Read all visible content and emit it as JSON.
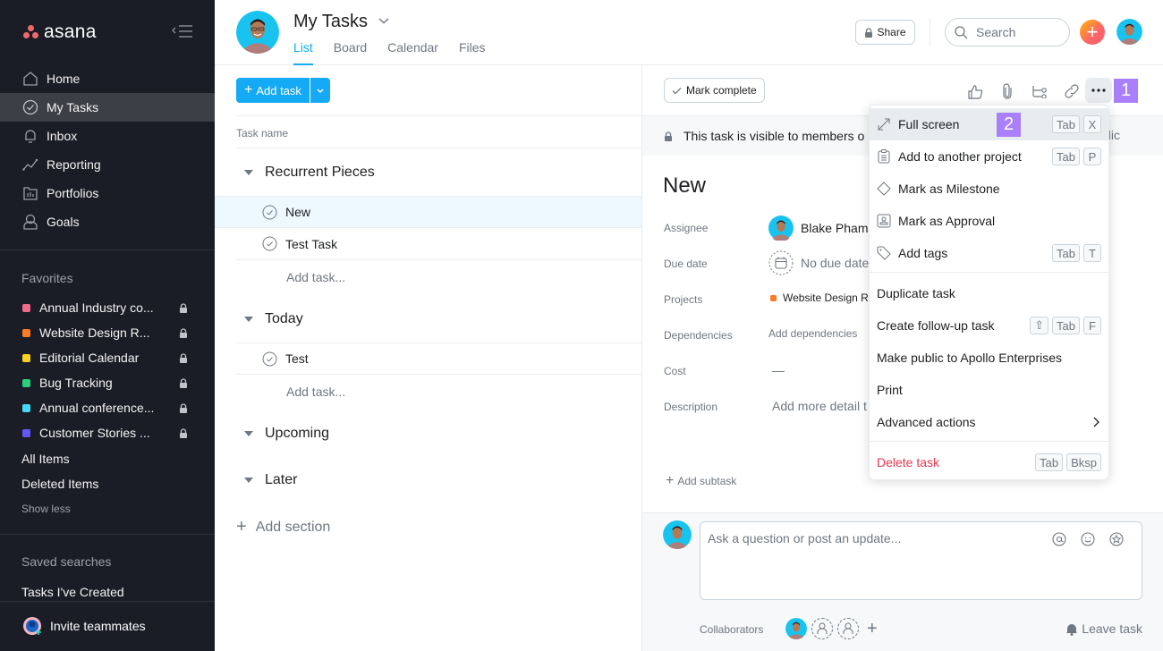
{
  "sidebar": {
    "logo_text": "asana",
    "nav": [
      {
        "label": "Home",
        "icon": "home-icon"
      },
      {
        "label": "My Tasks",
        "icon": "check-circle-icon",
        "active": true
      },
      {
        "label": "Inbox",
        "icon": "bell-icon"
      },
      {
        "label": "Reporting",
        "icon": "line-chart-icon"
      },
      {
        "label": "Portfolios",
        "icon": "portfolio-icon"
      },
      {
        "label": "Goals",
        "icon": "goals-icon"
      }
    ],
    "favorites_label": "Favorites",
    "favorites": [
      {
        "label": "Annual Industry co...",
        "color": "#f06a8a"
      },
      {
        "label": "Website Design R...",
        "color": "#fd7b23"
      },
      {
        "label": "Editorial Calendar",
        "color": "#f8d21c"
      },
      {
        "label": "Bug Tracking",
        "color": "#29d07c"
      },
      {
        "label": "Annual conference...",
        "color": "#43d9f7"
      },
      {
        "label": "Customer Stories ...",
        "color": "#6457f9"
      }
    ],
    "all_items": "All Items",
    "deleted_items": "Deleted Items",
    "show_less": "Show less",
    "saved_searches_label": "Saved searches",
    "saved_searches": [
      "Tasks I've Created"
    ],
    "invite": "Invite teammates"
  },
  "header": {
    "title": "My Tasks",
    "tabs": [
      "List",
      "Board",
      "Calendar",
      "Files"
    ],
    "active_tab": "List",
    "share": "Share",
    "search_placeholder": "Search"
  },
  "list": {
    "add_task": "Add task",
    "column_header": "Task name",
    "sections": [
      {
        "name": "Recurrent Pieces",
        "tasks": [
          "New",
          "Test Task"
        ],
        "add": "Add task..."
      },
      {
        "name": "Today",
        "tasks": [
          "Test"
        ],
        "add": "Add task..."
      },
      {
        "name": "Upcoming",
        "tasks": []
      },
      {
        "name": "Later",
        "tasks": []
      }
    ],
    "add_section": "Add section"
  },
  "detail": {
    "mark_complete": "Mark complete",
    "badge1": "1",
    "visibility": "This task is visible to members o",
    "visibility_tail": "blic",
    "title": "New",
    "fields": {
      "assignee_label": "Assignee",
      "assignee": "Blake Pham",
      "due_label": "Due date",
      "due": "No due date",
      "projects_label": "Projects",
      "project": "Website Design R",
      "project_color": "#fd7b23",
      "dependencies_label": "Dependencies",
      "dependencies": "Add dependencies",
      "cost_label": "Cost",
      "cost": "—",
      "description_label": "Description",
      "description": "Add more detail t"
    },
    "add_subtask": "Add subtask",
    "comment_placeholder": "Ask a question or post an update...",
    "collaborators_label": "Collaborators",
    "leave_task": "Leave task"
  },
  "menu": {
    "badge2": "2",
    "items": [
      {
        "label": "Full screen",
        "icon": "expand-icon",
        "keys": [
          "Tab",
          "X"
        ]
      },
      {
        "label": "Add to another project",
        "icon": "clipboard-icon",
        "keys": [
          "Tab",
          "P"
        ]
      },
      {
        "label": "Mark as Milestone",
        "icon": "diamond-icon",
        "keys": []
      },
      {
        "label": "Mark as Approval",
        "icon": "stamp-icon",
        "keys": []
      },
      {
        "label": "Add tags",
        "icon": "tag-icon",
        "keys": [
          "Tab",
          "T"
        ]
      },
      {
        "label": "Duplicate task",
        "keys": []
      },
      {
        "label": "Create follow-up task",
        "keys": [
          "⇧",
          "Tab",
          "F"
        ]
      },
      {
        "label": "Make public to Apollo Enterprises",
        "keys": []
      },
      {
        "label": "Print",
        "keys": []
      },
      {
        "label": "Advanced actions",
        "keys": []
      },
      {
        "label": "Delete task",
        "keys": [
          "Tab",
          "Bksp"
        ]
      }
    ]
  },
  "colors": {
    "accent": "#14aaf5",
    "sidebar_bg": "#1b1d26",
    "badge": "#a97ffc",
    "danger": "#e8384f"
  }
}
